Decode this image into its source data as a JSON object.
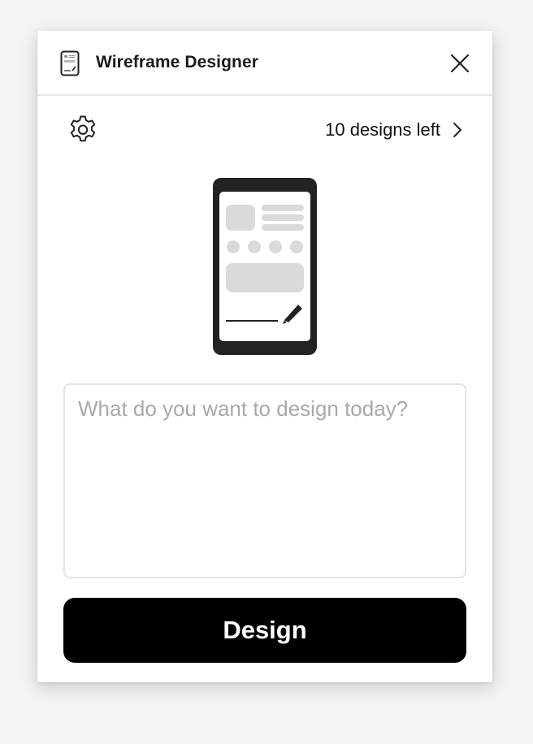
{
  "window": {
    "title": "Wireframe Designer",
    "app_icon": "wireframe-phone-icon",
    "close_icon": "close-icon"
  },
  "toolbar": {
    "settings_icon": "gear-icon",
    "designs_left_label": "10 designs left",
    "designs_left_icon": "chevron-right-icon"
  },
  "illustration": {
    "icon": "phone-wireframe-illustration"
  },
  "prompt": {
    "value": "",
    "placeholder": "What do you want to design today?"
  },
  "actions": {
    "design_label": "Design"
  },
  "colors": {
    "primary_button": "#000000",
    "button_text": "#ffffff",
    "placeholder": "#a9a9a9",
    "border": "#e3e3e3"
  }
}
